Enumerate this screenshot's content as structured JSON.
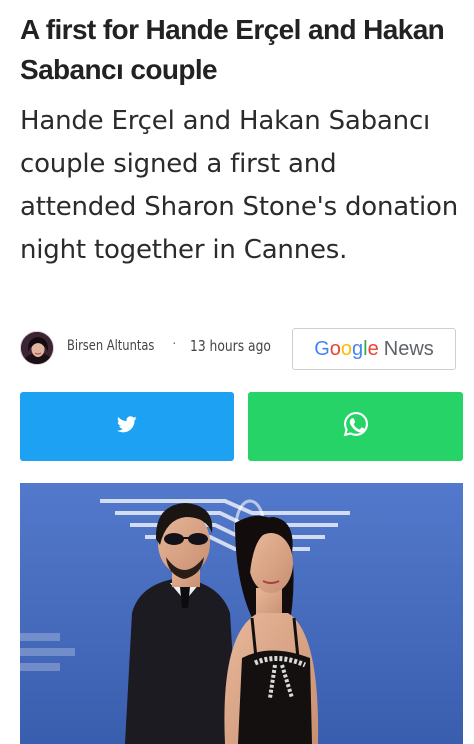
{
  "article": {
    "headline": "A first for Hande Erçel and Hakan Sabancı couple",
    "summary": "Hande Erçel and Hakan Sabancı couple signed a first and attended Sharon Stone's donation night together in Cannes."
  },
  "meta": {
    "author": "Birsen Altuntas",
    "separator": "·",
    "time": "13 hours ago"
  },
  "google_news": {
    "brand_letters": [
      "G",
      "o",
      "o",
      "g",
      "l",
      "e"
    ],
    "brand_colors": [
      "#4285F4",
      "#EA4335",
      "#FBBC05",
      "#4285F4",
      "#34A853",
      "#EA4335"
    ],
    "news_label": "News"
  },
  "share": {
    "twitter_icon": "twitter-bird-icon",
    "twitter_color": "#1DA1F2",
    "whatsapp_icon": "whatsapp-icon",
    "whatsapp_color": "#25D366"
  },
  "image": {
    "subject": "couple-photo"
  }
}
